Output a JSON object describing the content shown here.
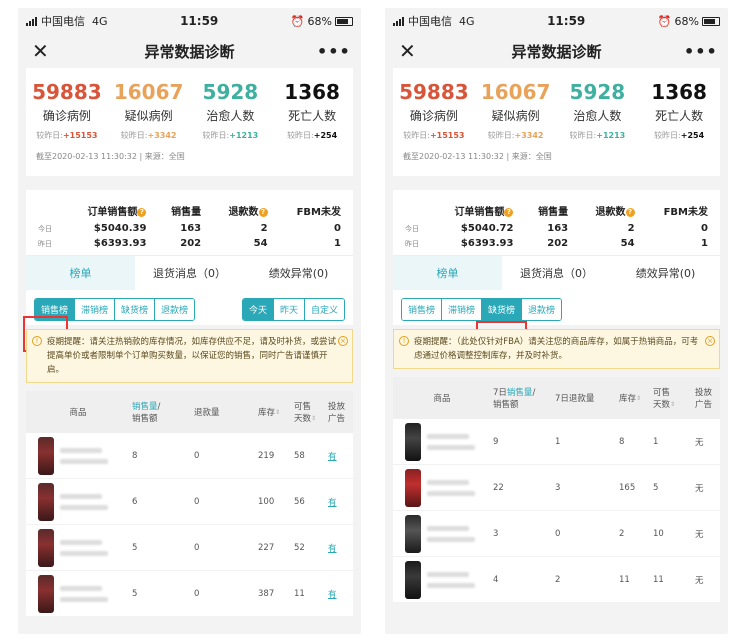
{
  "status": {
    "carrier": "中国电信",
    "network": "4G",
    "time": "11:59",
    "battery": "68%"
  },
  "navbar": {
    "title": "异常数据诊断",
    "close_icon": "close-icon",
    "more": "•••"
  },
  "colors": {
    "confirmed": "#d9553a",
    "suspected": "#e8a25a",
    "cured": "#3fb0a0",
    "death": "#111111",
    "accent": "#2aa8b8",
    "highlight": "#e33333"
  },
  "stats": [
    {
      "number": "59883",
      "label": "确诊病例",
      "delta_prefix": "较昨日:",
      "delta": "+15153"
    },
    {
      "number": "16067",
      "label": "疑似病例",
      "delta_prefix": "较昨日:",
      "delta": "+3342"
    },
    {
      "number": "5928",
      "label": "治愈人数",
      "delta_prefix": "较昨日:",
      "delta": "+1213"
    },
    {
      "number": "1368",
      "label": "死亡人数",
      "delta_prefix": "较昨日:",
      "delta": "+254"
    }
  ],
  "asof": "截至2020-02-13 11:30:32  |  来源：全国",
  "sales_headers": [
    "订单销售额",
    "销售量",
    "退款数",
    "FBM未发"
  ],
  "left": {
    "sales_rows": [
      {
        "label": "今日",
        "amount": "$5040.39",
        "qty": "163",
        "refund": "2",
        "fbm": "0"
      },
      {
        "label": "昨日",
        "amount": "$6393.93",
        "qty": "202",
        "refund": "54",
        "fbm": "1"
      }
    ],
    "tabs": [
      "榜单",
      "退货消息（0）",
      "绩效异常(0)"
    ],
    "rank_buttons": [
      "销售榜",
      "滞销榜",
      "缺货榜",
      "退款榜"
    ],
    "range_buttons": [
      "今天",
      "昨天",
      "自定义"
    ],
    "notice": "疫期提醒：请关注热销款的库存情况，如库存供应不足，请及时补货，或尝试提高单价或者限制单个订单购买数量，以保证您的销售，同时广告请谨慎开启。",
    "table_headers": {
      "product": "商品",
      "sales_a": "销售量",
      "sales_b": "/",
      "sales_c": "销售额",
      "refund": "退款量",
      "stock": "库存",
      "days_a": "可售",
      "days_b": "天数",
      "ad_a": "投放",
      "ad_b": "广告"
    },
    "rows": [
      {
        "sales": "8",
        "refund": "0",
        "stock": "219",
        "days": "58",
        "ad": "有"
      },
      {
        "sales": "6",
        "refund": "0",
        "stock": "100",
        "days": "56",
        "ad": "有"
      },
      {
        "sales": "5",
        "refund": "0",
        "stock": "227",
        "days": "52",
        "ad": "有"
      },
      {
        "sales": "5",
        "refund": "0",
        "stock": "387",
        "days": "11",
        "ad": "有"
      }
    ]
  },
  "right": {
    "sales_rows": [
      {
        "label": "今日",
        "amount": "$5040.72",
        "qty": "163",
        "refund": "2",
        "fbm": "0"
      },
      {
        "label": "昨日",
        "amount": "$6393.93",
        "qty": "202",
        "refund": "54",
        "fbm": "1"
      }
    ],
    "tabs": [
      "榜单",
      "退货消息（0）",
      "绩效异常(0)"
    ],
    "rank_buttons": [
      "销售榜",
      "滞销榜",
      "缺货榜",
      "退款榜"
    ],
    "notice": "疫期提醒：（此处仅针对FBA）请关注您的商品库存，如属于热销商品，可考虑通过价格调整控制库存，并及时补货。",
    "table_headers": {
      "product": "商品",
      "sales_pre": "7日",
      "sales_a": "销售量",
      "sales_b": "/",
      "sales_c": "销售额",
      "refund": "7日退款量",
      "stock": "库存",
      "days_a": "可售",
      "days_b": "天数",
      "ad_a": "投放",
      "ad_b": "广告"
    },
    "rows": [
      {
        "sales": "9",
        "refund": "1",
        "stock": "8",
        "days": "1",
        "ad": "无"
      },
      {
        "sales": "22",
        "refund": "3",
        "stock": "165",
        "days": "5",
        "ad": "无"
      },
      {
        "sales": "3",
        "refund": "0",
        "stock": "2",
        "days": "10",
        "ad": "无"
      },
      {
        "sales": "4",
        "refund": "2",
        "stock": "11",
        "days": "11",
        "ad": "无"
      }
    ]
  }
}
